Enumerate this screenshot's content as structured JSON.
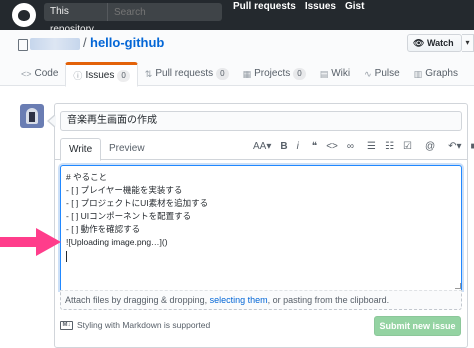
{
  "header": {
    "search_scope": "This repository",
    "search_placeholder": "Search",
    "nav": [
      "Pull requests",
      "Issues",
      "Gist"
    ]
  },
  "repo": {
    "separator": "/",
    "name": "hello-github",
    "watch_label": "Watch",
    "watch_caret": "▾"
  },
  "tabs": [
    {
      "icon": "<>",
      "label": "Code",
      "count": ""
    },
    {
      "icon": "ⓘ",
      "label": "Issues",
      "count": "0"
    },
    {
      "icon": "⇅",
      "label": "Pull requests",
      "count": "0"
    },
    {
      "icon": "▦",
      "label": "Projects",
      "count": "0"
    },
    {
      "icon": "▤",
      "label": "Wiki",
      "count": ""
    },
    {
      "icon": "∿",
      "label": "Pulse",
      "count": ""
    },
    {
      "icon": "▥",
      "label": "Graphs",
      "count": ""
    }
  ],
  "issue_form": {
    "title_value": "音楽再生画面の作成",
    "write_tab": "Write",
    "preview_tab": "Preview",
    "toolbar": {
      "heading": "AA▾",
      "bold": "B",
      "italic": "i",
      "quote": "❝",
      "code": "<>",
      "link": "∞",
      "ul": "☰",
      "ol": "☷",
      "task": "☑",
      "mention": "@",
      "reply": "↶▾",
      "bookmark": "■"
    },
    "body_lines": [
      "# やること",
      "- [ ] プレイヤー機能を実装する",
      "- [ ] プロジェクトにUI素材を追加する",
      "- [ ] UIコンポーネントを配置する",
      "- [ ] 動作を確認する",
      "![Uploading image.png…]()"
    ],
    "attach_prefix": "Attach files by dragging & dropping, ",
    "attach_link": "selecting them",
    "attach_suffix": ", or pasting from the clipboard.",
    "markdown_note": "Styling with Markdown is supported",
    "markdown_icon_text": "M↓",
    "submit_label": "Submit new issue"
  },
  "colors": {
    "header_bg": "#24292e",
    "link": "#0366d6",
    "tab_accent": "#e36209",
    "submit_disabled": "#94d3a2",
    "arrow": "#ff3d8b"
  }
}
